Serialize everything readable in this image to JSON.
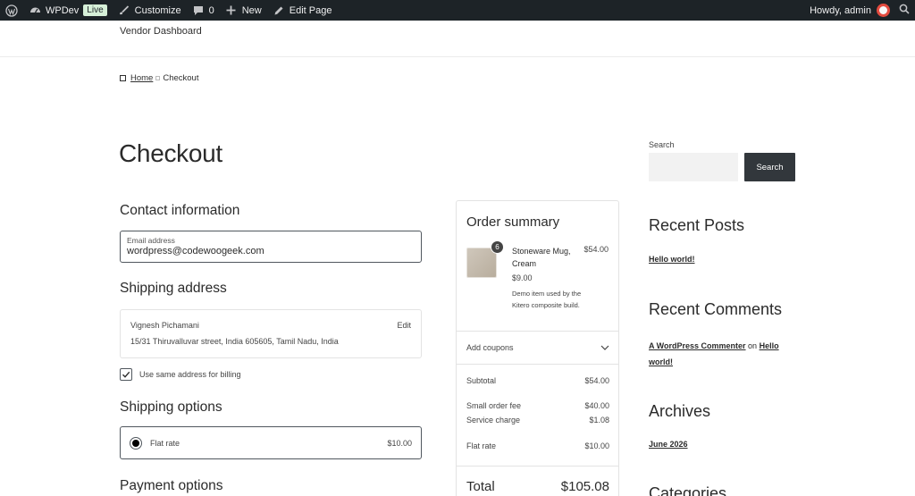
{
  "admin_bar": {
    "site_name": "WPDev",
    "live_badge": "Live",
    "customize": "Customize",
    "comments_count": "0",
    "new": "New",
    "edit_page": "Edit Page",
    "greeting": "Howdy, admin"
  },
  "site": {
    "title": "Vendor Dashboard"
  },
  "breadcrumb": {
    "home": "Home",
    "current": "Checkout"
  },
  "page": {
    "title": "Checkout"
  },
  "contact": {
    "heading": "Contact information",
    "email_label": "Email address",
    "email_value": "wordpress@codewoogeek.com"
  },
  "shipping_address": {
    "heading": "Shipping address",
    "name": "Vignesh Pichamani",
    "address": "15/31 Thiruvalluvar street, India 605605, Tamil Nadu, India",
    "edit": "Edit",
    "same_billing": "Use same address for billing"
  },
  "shipping_options": {
    "heading": "Shipping options",
    "option_label": "Flat rate",
    "option_price": "$10.00"
  },
  "payment": {
    "heading": "Payment options"
  },
  "order_summary": {
    "heading": "Order summary",
    "item": {
      "quantity": "6",
      "name": "Stoneware Mug, Cream",
      "price": "$54.00",
      "unit_price": "$9.00",
      "description": "Demo item used by the Kitero composite build."
    },
    "coupons": "Add coupons",
    "rows": [
      {
        "label": "Subtotal",
        "value": "$54.00"
      },
      {
        "label": "Small order fee",
        "value": "$40.00"
      },
      {
        "label": "Service charge",
        "value": "$1.08"
      },
      {
        "label": "Flat rate",
        "value": "$10.00"
      }
    ],
    "total_label": "Total",
    "total_value": "$105.08"
  },
  "sidebar": {
    "search_label": "Search",
    "search_button": "Search",
    "recent_posts_heading": "Recent Posts",
    "recent_post": "Hello world!",
    "recent_comments_heading": "Recent Comments",
    "comment_author": "A WordPress Commenter",
    "comment_on": "on",
    "comment_post": "Hello world!",
    "archives_heading": "Archives",
    "archive_item": "June 2026",
    "categories_heading": "Categories"
  },
  "colors": {
    "admin_bar_bg": "#1d2327",
    "live_badge_bg": "#d6f0d8",
    "search_button_bg": "#32373c"
  }
}
